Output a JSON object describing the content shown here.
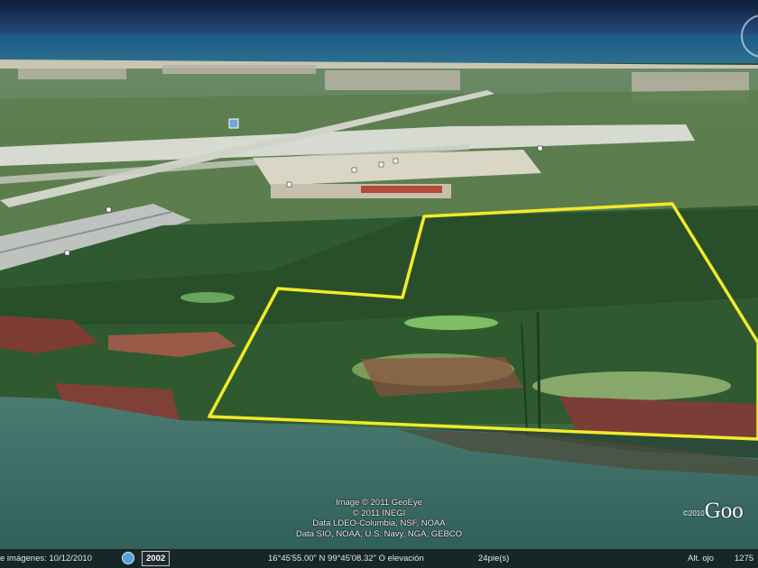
{
  "attribution": [
    "Image © 2011 GeoEye",
    "© 2011 INEGI",
    "Data LDEO-Columbia, NSF, NOAA",
    "Data SIO, NOAA, U.S. Navy, NGA, GEBCO"
  ],
  "logo": {
    "year": "©2010",
    "word": "Goo"
  },
  "statusbar": {
    "image_date": "e imágenes: 10/12/2010",
    "year": "2002",
    "coordinates": "16°45'55.00\" N  99°45'08.32\" O  elevación",
    "elevation": "24pie(s)",
    "eye_alt_label": "Alt. ojo",
    "eye_alt_value": "1275"
  },
  "colors": {
    "boundary": "#f2ea2a",
    "ocean": "#1c4f6e",
    "lagoon": "#3f6b63",
    "forest": "#2f5a30",
    "field": "#5f7f4a",
    "runway": "#d8dcd0",
    "mud": "#8a4a38"
  },
  "icons": [
    "compass-icon",
    "clock-icon",
    "airport-icon"
  ]
}
